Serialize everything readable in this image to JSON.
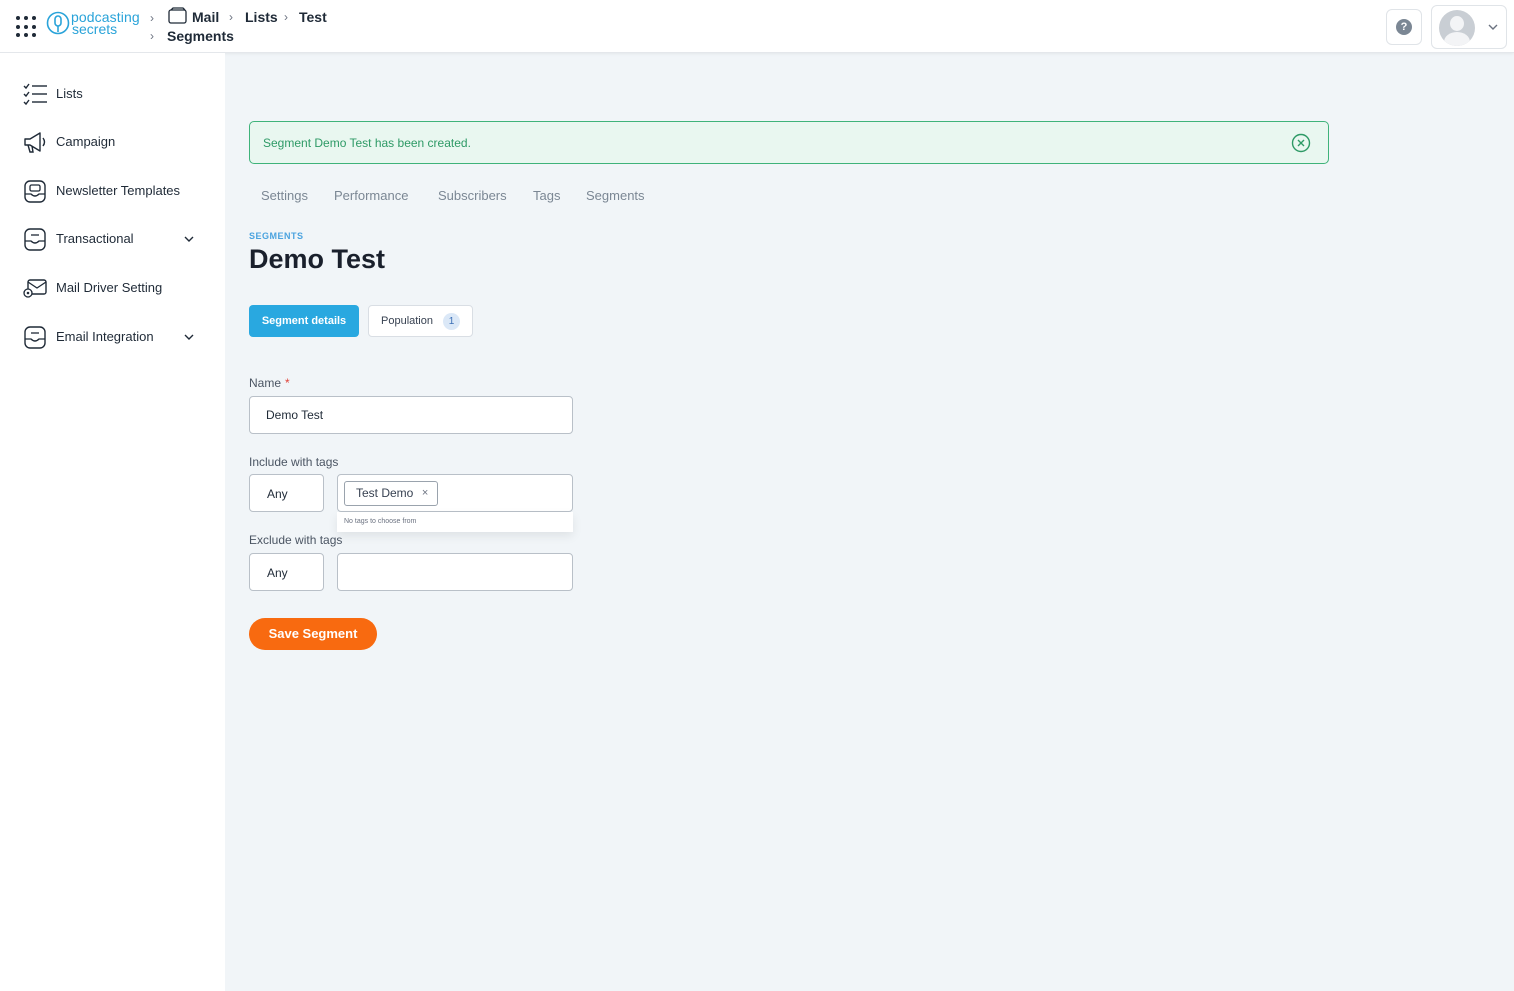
{
  "header": {
    "logo_line1": "podcasting",
    "logo_line2": "secrets",
    "breadcrumb": [
      "Mail",
      "Lists",
      "Test",
      "Segments"
    ],
    "help_icon": "question-icon",
    "help_symbol": "?"
  },
  "sidebar": {
    "items": [
      {
        "label": "Lists",
        "icon": "checklist-icon"
      },
      {
        "label": "Campaign",
        "icon": "megaphone-icon"
      },
      {
        "label": "Newsletter Templates",
        "icon": "template-icon"
      },
      {
        "label": "Transactional",
        "icon": "inbox-icon",
        "expandable": true
      },
      {
        "label": "Mail Driver Setting",
        "icon": "mail-settings-icon"
      },
      {
        "label": "Email Integration",
        "icon": "integration-icon",
        "expandable": true
      }
    ]
  },
  "alert": {
    "message": "Segment Demo Test has been created.",
    "color": "#3fb37a"
  },
  "tabs": [
    "Settings",
    "Performance",
    "Subscribers",
    "Tags",
    "Segments"
  ],
  "page": {
    "eyebrow": "SEGMENTS",
    "title": "Demo Test"
  },
  "subtabs": {
    "details_label": "Segment details",
    "population_label": "Population",
    "population_count": "1"
  },
  "form": {
    "name_label": "Name",
    "name_required": "*",
    "name_value": "Demo Test",
    "include_label": "Include with tags",
    "include_mode": "Any",
    "include_tags": [
      "Test Demo"
    ],
    "include_tag_remove": "×",
    "include_dropdown_message": "No tags to choose from",
    "exclude_label": "Exclude with tags",
    "exclude_mode": "Any",
    "exclude_value": "",
    "save_label": "Save Segment"
  },
  "colors": {
    "accent": "#29a8e0",
    "save": "#f86a10",
    "success": "#3fb37a"
  }
}
